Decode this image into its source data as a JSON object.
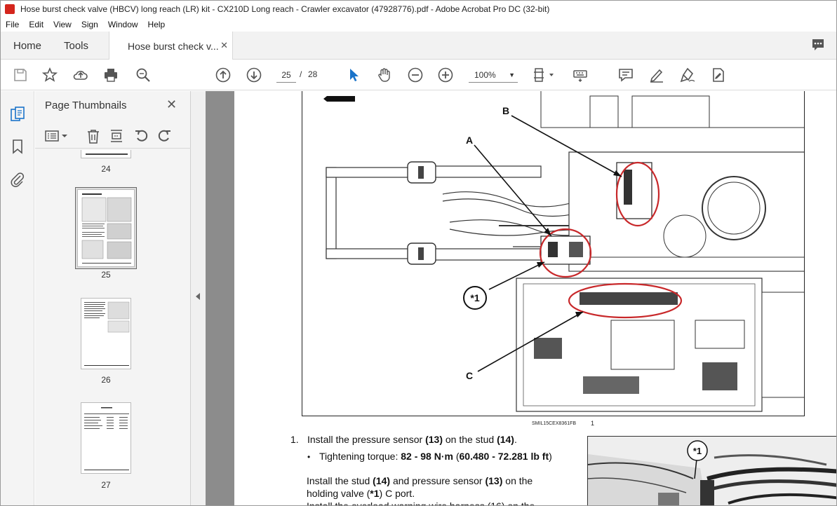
{
  "window": {
    "title": "Hose burst check valve (HBCV) long reach (LR) kit - CX210D Long reach - Crawler excavator (47928776).pdf - Adobe Acrobat Pro DC (32-bit)"
  },
  "menu": {
    "file": "File",
    "edit": "Edit",
    "view": "View",
    "sign": "Sign",
    "window": "Window",
    "help": "Help"
  },
  "tabs": {
    "home": "Home",
    "tools": "Tools",
    "document": "Hose burst check v...",
    "close": "✕"
  },
  "toolbar": {
    "current_page": "25",
    "separator": "/",
    "total_pages": "28",
    "zoom": "100%"
  },
  "thumbnails": {
    "title": "Page Thumbnails",
    "close": "✕",
    "pages": [
      "24",
      "25",
      "26",
      "27"
    ]
  },
  "document": {
    "callouts": {
      "a": "A",
      "b": "B",
      "c": "C",
      "star1": "*1"
    },
    "caption": "SMIL15CEX8361FB",
    "caption_num": "1",
    "step_num": "1.",
    "step_text_pre": "Install the pressure sensor ",
    "step_ref1": "(13)",
    "step_text_mid": " on the stud ",
    "step_ref2": "(14)",
    "step_text_end": ".",
    "bullet": "•",
    "torque_label": "Tightening torque: ",
    "torque_value": "82 - 98 N·m",
    "torque_alt_open": " (",
    "torque_alt": "60.480 - 72.281 lb ft",
    "torque_alt_close": ")",
    "line3_pre": "Install the stud ",
    "line3_ref1": "(14)",
    "line3_mid": " and pressure sensor ",
    "line3_ref2": "(13)",
    "line3_end": " on the",
    "line4_pre": "holding valve (",
    "line4_ref": "*1",
    "line4_end": ") C port.",
    "line5": "Install the overload warning wire harness (16) on the",
    "photo_callout": "*1"
  }
}
